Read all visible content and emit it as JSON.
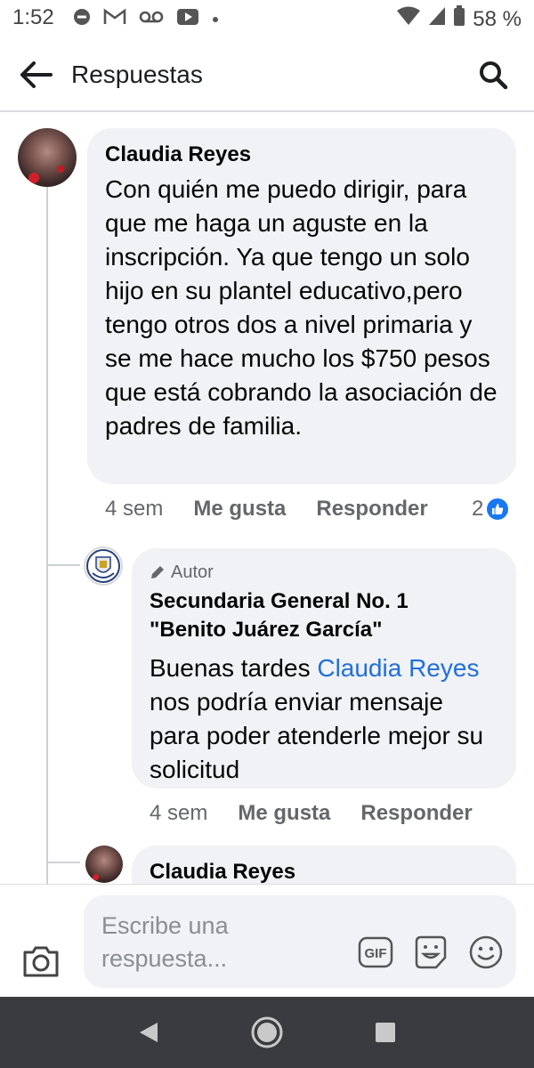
{
  "status_bar": {
    "time": "1:52",
    "battery": "58 %",
    "icons": [
      "do-not-disturb-icon",
      "gmail-icon",
      "voicemail-icon",
      "youtube-icon",
      "dot-icon",
      "wifi-icon",
      "signal-icon",
      "battery-icon"
    ]
  },
  "header": {
    "title": "Respuestas",
    "back_icon": "arrow-left-icon",
    "search_icon": "search-icon"
  },
  "comments": [
    {
      "author": "Claudia Reyes",
      "text": "Con quién me puedo dirigir, para que me haga un aguste en la inscripción. Ya que tengo un solo hijo en su plantel educativo,pero tengo otros dos a nivel primaria y se me hace mucho los $750 pesos que está cobrando la asociación de padres de familia.",
      "time": "4 sem",
      "like_label": "Me gusta",
      "reply_label": "Responder",
      "reaction_count": "2"
    },
    {
      "badge": "Autor",
      "author": "Secundaria General No. 1 \"Benito Juárez García\"",
      "text_before": "Buenas tardes ",
      "mention": "Claudia Reyes",
      "text_after": " nos podría enviar mensaje para poder atenderle mejor su solicitud",
      "time": "4 sem",
      "like_label": "Me gusta",
      "reply_label": "Responder"
    },
    {
      "author": "Claudia Reyes"
    }
  ],
  "composer": {
    "placeholder": "Escribe una respuesta...",
    "gif_label": "GIF",
    "icons": [
      "camera-icon",
      "gif-icon",
      "sticker-icon",
      "emoji-icon"
    ]
  },
  "nav": {
    "icons": [
      "back-triangle-icon",
      "home-circle-icon",
      "recents-square-icon"
    ]
  },
  "colors": {
    "bubble": "#f0f2f5",
    "mention": "#216fdb",
    "like": "#1877f2",
    "nav_bar": "#3a3b3e",
    "meta": "#65676b"
  }
}
